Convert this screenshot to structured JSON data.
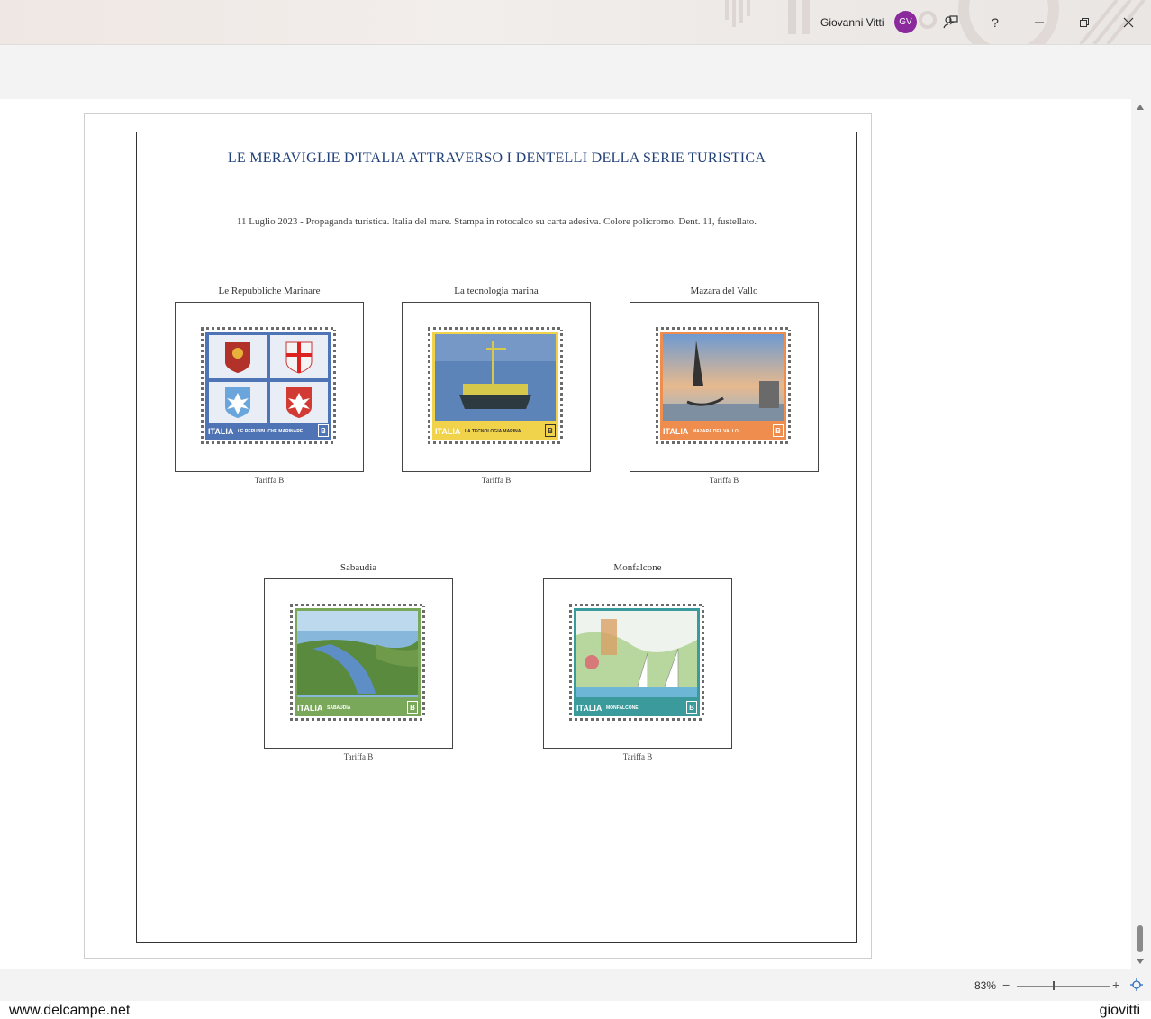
{
  "titlebar": {
    "user_name": "Giovanni Vitti",
    "avatar_initials": "GV"
  },
  "document": {
    "title": "LE MERAVIGLIE D'ITALIA ATTRAVERSO I DENTELLI DELLA SERIE TURISTICA",
    "subtitle": "11 Luglio 2023 - Propaganda turistica. Italia del mare. Stampa in rotocalco su carta adesiva. Colore policromo. Dent. 11, fustellato.",
    "stamps": [
      {
        "name": "Le Repubbliche Marinare",
        "tariff": "Tariffa B",
        "country": "ITALIA",
        "caption": "LE REPUBBLICHE MARINARE",
        "band_color": "#4f74b5"
      },
      {
        "name": "La tecnologia marina",
        "tariff": "Tariffa B",
        "country": "ITALIA",
        "caption": "LA TECNOLOGIA MARINA",
        "band_color": "#f1d24b"
      },
      {
        "name": "Mazara del Vallo",
        "tariff": "Tariffa B",
        "country": "ITALIA",
        "caption": "MAZARA DEL VALLO",
        "band_color": "#ef8d4e"
      },
      {
        "name": "Sabaudia",
        "tariff": "Tariffa B",
        "country": "ITALIA",
        "caption": "SABAUDIA",
        "band_color": "#7aa85a"
      },
      {
        "name": "Monfalcone",
        "tariff": "Tariffa B",
        "country": "ITALIA",
        "caption": "MONFALCONE",
        "band_color": "#3a9a9c"
      }
    ],
    "stamp_denomination": "B"
  },
  "statusbar": {
    "zoom": "83%",
    "zoom_minus": "−",
    "zoom_plus": "+"
  },
  "footer": {
    "left": "www.delcampe.net",
    "right": "giovitti"
  },
  "icons": {
    "feedback": "feedback-icon",
    "help": "help-icon",
    "minimize": "minimize-icon",
    "restore": "restore-icon",
    "close": "close-icon",
    "fit": "fit-page-icon"
  }
}
